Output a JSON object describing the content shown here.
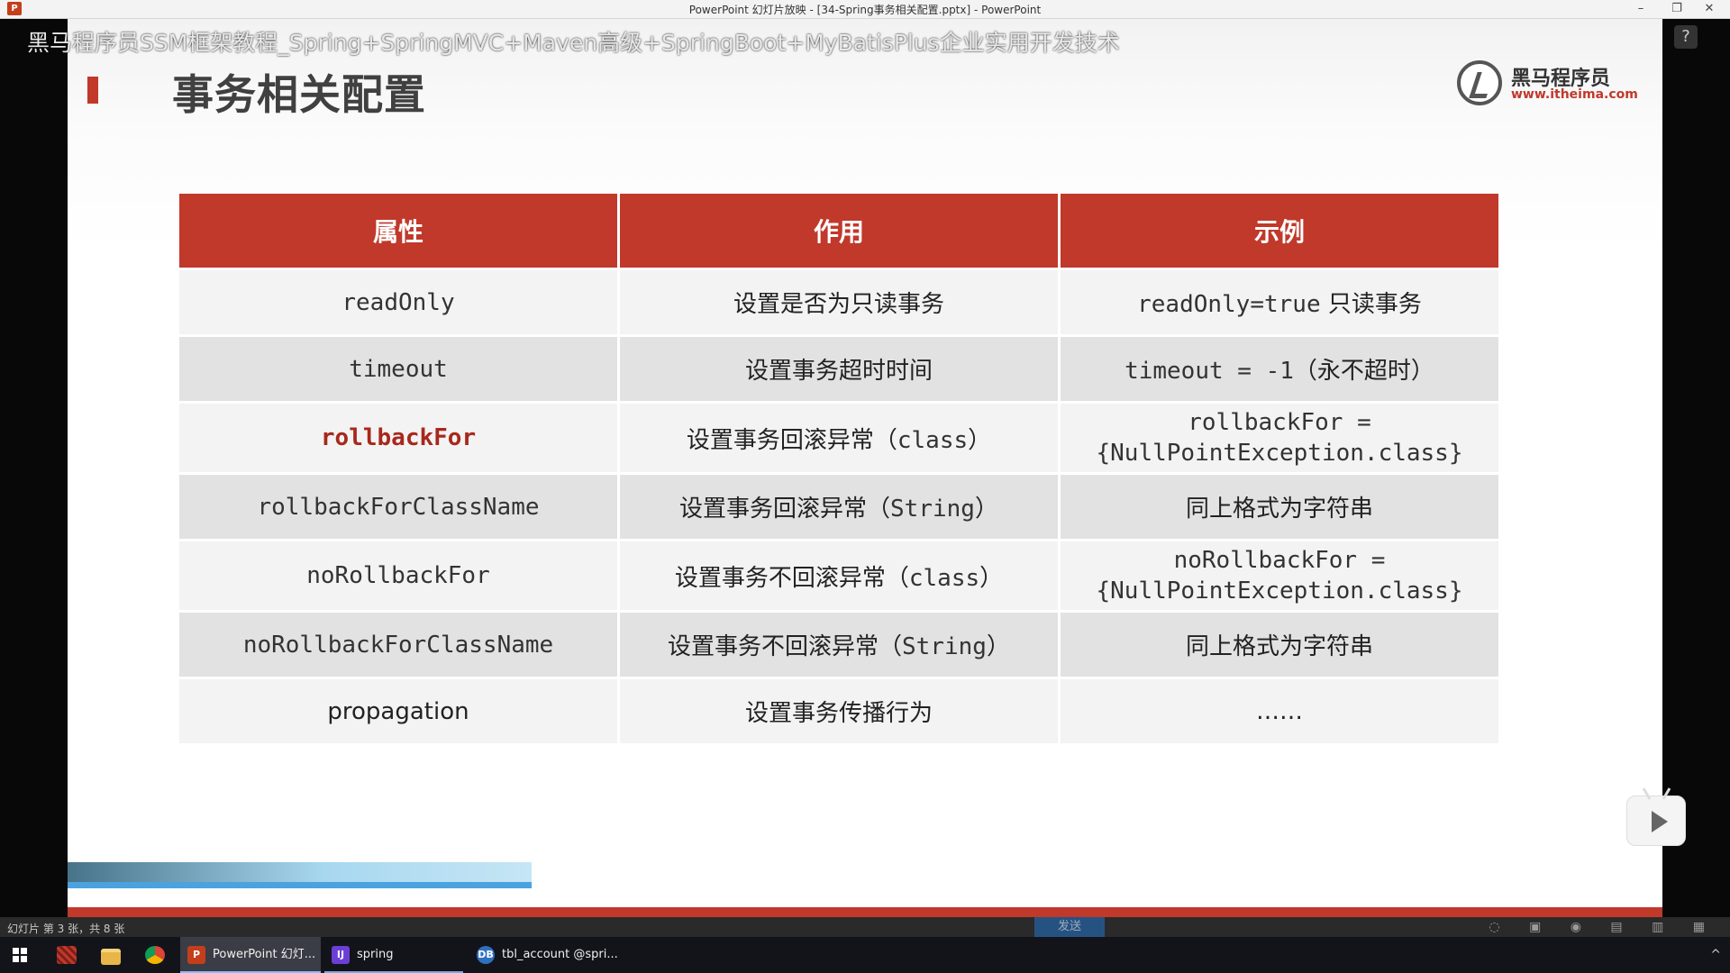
{
  "window": {
    "title": "PowerPoint 幻灯片放映 - [34-Spring事务相关配置.pptx] - PowerPoint",
    "app_icon": "P",
    "minimize": "–",
    "restore": "❐",
    "close": "✕"
  },
  "overlay": {
    "course_banner": "黑马程序员SSM框架教程_Spring+SpringMVC+Maven高级+SpringBoot+MyBatisPlus企业实用开发技术",
    "help_icon_glyph": "?"
  },
  "slide": {
    "title": "事务相关配置",
    "logo": {
      "brand": "黑马程序员",
      "url": "www.itheima.com"
    },
    "table": {
      "headers": [
        "属性",
        "作用",
        "示例"
      ],
      "rows": [
        {
          "attr": "readOnly",
          "desc": "设置是否为只读事务",
          "example_code": "readOnly=true",
          "example_text": " 只读事务"
        },
        {
          "attr": "timeout",
          "desc": "设置事务超时时间",
          "example_code": "timeout = -1",
          "example_text": "（永不超时）"
        },
        {
          "attr": "rollbackFor",
          "desc_prefix": "设置事务回滚异常（",
          "desc_code": "class",
          "desc_suffix": "）",
          "example_line1": "rollbackFor =",
          "example_line2": "{NullPointException.class}"
        },
        {
          "attr": "rollbackForClassName",
          "desc_prefix": "设置事务回滚异常（",
          "desc_code": "String",
          "desc_suffix": "）",
          "example": "同上格式为字符串"
        },
        {
          "attr": "noRollbackFor",
          "desc_prefix": "设置事务不回滚异常（",
          "desc_code": "class",
          "desc_suffix": "）",
          "example_line1": "noRollbackFor =",
          "example_line2": "{NullPointException.class}"
        },
        {
          "attr": "noRollbackForClassName",
          "desc_prefix": "设置事务不回滚异常（",
          "desc_code": "String",
          "desc_suffix": "）",
          "example": "同上格式为字符串"
        },
        {
          "attr": "propagation",
          "desc": "设置事务传播行为",
          "example": "……"
        }
      ]
    }
  },
  "statusbar": {
    "text": "幻灯片 第 3 张，共 8 张",
    "send_label": "发送"
  },
  "taskbar": {
    "apps": [
      {
        "label": "PowerPoint 幻灯...",
        "icon": "P",
        "color": "#c43e1c"
      },
      {
        "label": "spring",
        "icon": "IJ",
        "color": "#6b3fd6"
      },
      {
        "label": "tbl_account @spri...",
        "icon": "DB",
        "color": "#2f6fbf"
      }
    ],
    "tray_chevron": "^"
  }
}
